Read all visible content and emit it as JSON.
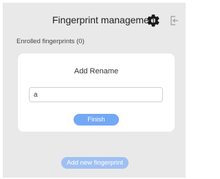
{
  "header": {
    "title": "Fingerprint management",
    "settings_icon": "gear-icon",
    "exit_icon": "exit-icon"
  },
  "enrolled": {
    "text": "Enrolled fingerprints (0)"
  },
  "dialog": {
    "title": "Add Rename",
    "input_value": "a",
    "finish_label": "Finish"
  },
  "footer": {
    "add_label": "Add new fingerprint"
  },
  "colors": {
    "background": "#e9e9e9",
    "card": "#ffffff",
    "primary_button": "#73a8f4",
    "secondary_button": "#9fc0f2"
  }
}
